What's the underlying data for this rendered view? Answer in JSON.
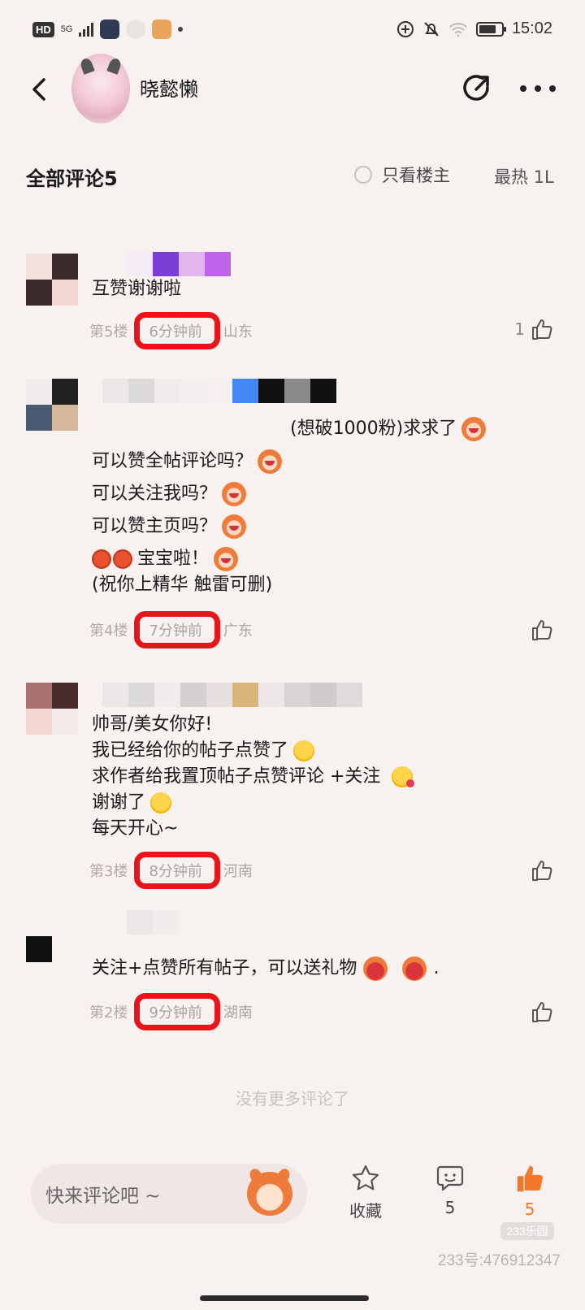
{
  "status_bar": {
    "hd": "HD",
    "network": "5G",
    "time": "15:02",
    "battery_level_pct": 80
  },
  "header": {
    "username": "晓懿懒"
  },
  "comments_header": {
    "title": "全部评论",
    "count": "5",
    "only_owner_label": "只看楼主",
    "sort_label": "最热 1L"
  },
  "comments": [
    {
      "floor": "第5楼",
      "time": "6分钟前",
      "region": "山东",
      "likes": "1",
      "lines": [
        "互赞谢谢啦"
      ]
    },
    {
      "floor": "第4楼",
      "time": "7分钟前",
      "region": "广东",
      "likes": "",
      "lines": [
        "(想破1000粉)求求了",
        "可以赞全帖评论吗？",
        "可以关注我吗？",
        "可以赞主页吗？",
        "宝宝啦！",
        "(祝你上精华 触雷可删)"
      ]
    },
    {
      "floor": "第3楼",
      "time": "8分钟前",
      "region": "河南",
      "likes": "",
      "lines": [
        "帅哥/美女你好!",
        "我已经给你的帖子点赞了",
        "求作者给我置顶帖子点赞评论  +关注",
        "谢谢了",
        "每天开心~"
      ]
    },
    {
      "floor": "第2楼",
      "time": "9分钟前",
      "region": "湖南",
      "likes": "",
      "lines": [
        "关注+点赞所有帖子，可以送礼物",
        "."
      ]
    }
  ],
  "no_more": "没有更多评论了",
  "bottom_bar": {
    "input_placeholder": "快来评论吧 ~",
    "favorite_label": "收藏",
    "comment_count": "5",
    "like_count": "5"
  },
  "watermark": {
    "logo": "233乐园",
    "text": "233号:476912347"
  },
  "colors": {
    "background": "#f7f1f0",
    "accent": "#f2772a",
    "highlight_circle": "#e8141a"
  }
}
